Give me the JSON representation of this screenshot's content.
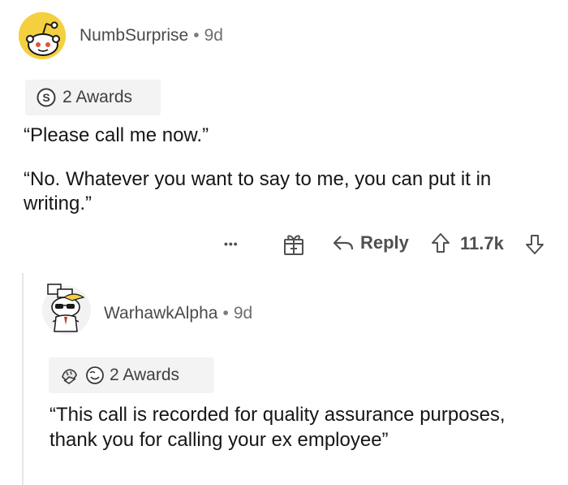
{
  "comment1": {
    "username": "NumbSurprise",
    "age": "9d",
    "awards_label": "2 Awards",
    "paragraphs": [
      "“Please call me now.”",
      "“No. Whatever you want to say to me, you can put it in writing.”"
    ],
    "more_label": "•••",
    "reply_label": "Reply",
    "score": "11.7k"
  },
  "comment2": {
    "username": "WarhawkAlpha",
    "age": "9d",
    "awards_label": "2 Awards",
    "paragraphs": [
      "“This call is recorded for quality assurance purposes, thank you for calling your ex employee”"
    ]
  },
  "separator": "•",
  "colors": {
    "avatar_yellow": "#f4d03f",
    "award_bg": "#f3f3f3",
    "text": "#1a1a1b"
  },
  "icons": [
    "snoo-avatar-icon",
    "award-s-icon",
    "gift-icon",
    "reply-icon",
    "upvote-icon",
    "downvote-icon",
    "snoo-sunglasses-avatar-icon",
    "award-hands-icon",
    "award-smile-icon"
  ]
}
